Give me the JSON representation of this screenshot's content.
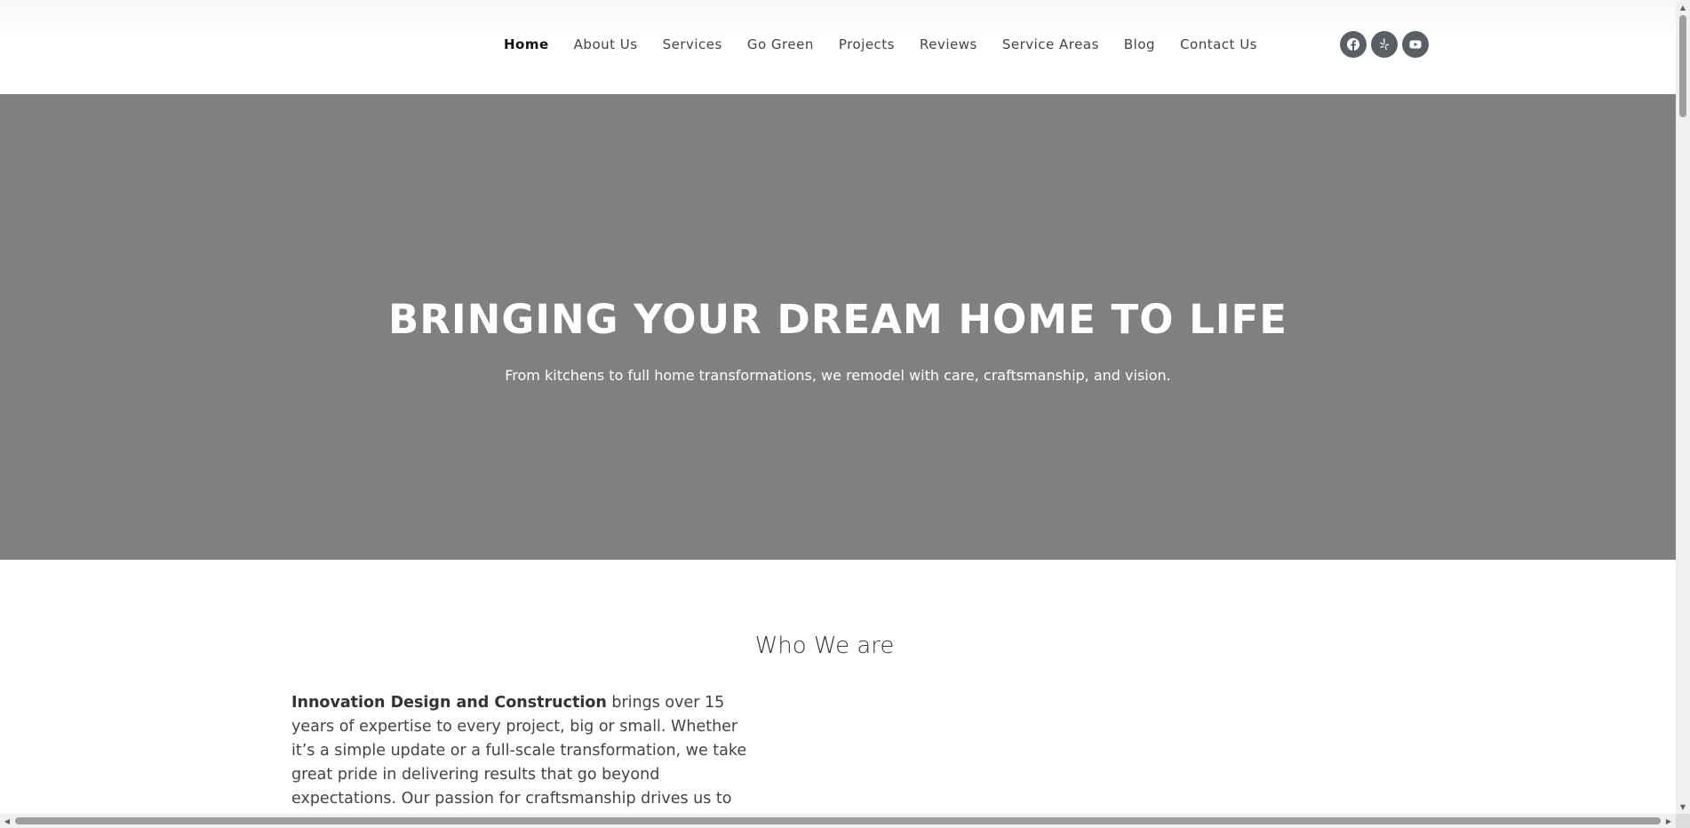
{
  "nav": {
    "items": [
      {
        "label": "Home",
        "active": true
      },
      {
        "label": "About Us"
      },
      {
        "label": "Services"
      },
      {
        "label": "Go Green"
      },
      {
        "label": "Projects"
      },
      {
        "label": "Reviews"
      },
      {
        "label": "Service Areas"
      },
      {
        "label": "Blog"
      },
      {
        "label": "Contact Us"
      }
    ]
  },
  "social": {
    "icons": [
      "facebook-icon",
      "yelp-icon",
      "youtube-icon"
    ],
    "color": "#5a5f66"
  },
  "hero": {
    "title": "BRINGING YOUR DREAM HOME TO LIFE",
    "subtitle": "From kitchens to full home transformations, we remodel with care, craftsmanship, and vision.",
    "background": "#808080"
  },
  "about": {
    "title": "Who We are",
    "company": "Innovation Design and Construction",
    "body": " brings over 15 years of expertise to every project, big or small. Whether it’s a simple update or a full-scale transformation, we take great pride in delivering results that go beyond expectations. Our passion for craftsmanship drives us to"
  },
  "colors": {
    "nav_text": "#444444",
    "nav_active": "#111111",
    "heading": "#3a3a3a"
  }
}
